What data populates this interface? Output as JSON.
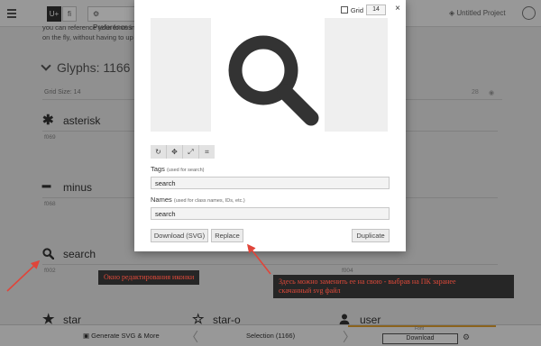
{
  "topbar": {
    "menu_icon": "hamburger-icon",
    "mode_unicode": "U+",
    "mode_ligature": "fi",
    "preferences_label": "Preferences",
    "project_title": "Untitled Project"
  },
  "intro_lines": [
    "you can reference your fonts in",
    "on the fly, without having to up"
  ],
  "glyphs": {
    "header": "Glyphs: 1166",
    "grid_size": "Grid Size: 14",
    "grid_value_right": "28",
    "items": [
      {
        "name": "asterisk",
        "code": "f069",
        "icon": "asterisk-icon",
        "glyph": "✱"
      },
      {
        "name": "minus",
        "code": "f068",
        "icon": "minus-icon",
        "glyph": "━"
      },
      {
        "name": "search",
        "code": "f002",
        "icon": "search-icon",
        "glyph": ""
      },
      {
        "name": "star",
        "code": "",
        "icon": "star-icon",
        "glyph": "★"
      },
      {
        "name": "star-o",
        "code": "",
        "icon": "star-o-icon",
        "glyph": "☆"
      },
      {
        "name": "user",
        "code": "",
        "icon": "user-icon",
        "glyph": ""
      }
    ],
    "other_code": "f004"
  },
  "modal": {
    "grid_label": "Grid",
    "grid_value": "14",
    "close": "×",
    "tools": [
      "↻",
      "✥",
      "⤢",
      "⌗"
    ],
    "tags_label": "Tags",
    "tags_hint": "(used for search)",
    "tags_value": "search",
    "names_label": "Names",
    "names_hint": "(used for class names, IDs, etc.)",
    "names_value": "search",
    "download_label": "Download (SVG)",
    "replace_label": "Replace",
    "duplicate_label": "Duplicate"
  },
  "bottombar": {
    "generate_label": "Generate SVG & More",
    "selection_label": "Selection (1166)",
    "font_label": "Font",
    "download_label": "Download"
  },
  "annotations": {
    "left_note": "Окно редактирования иконки",
    "right_note_line1": "Здесь можно заменить ее на свою - выбрав на ПК заранее",
    "right_note_line2": "скачанный svg файл"
  },
  "colors": {
    "annotation_text": "#e04a3a",
    "annotation_bg": "#262626",
    "arrow": "#e0453a",
    "progress_accent": "#e0a030"
  }
}
